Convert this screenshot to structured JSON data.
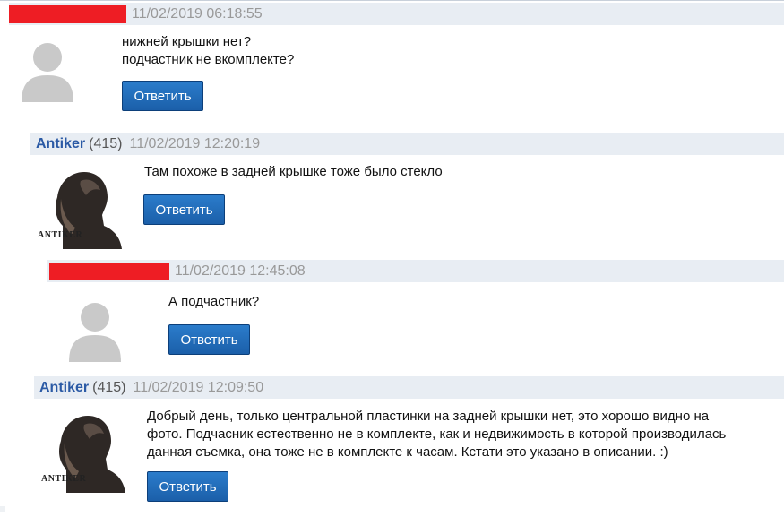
{
  "colors": {
    "accent": "#1b5fa9",
    "redaction": "#ee1d24",
    "header_bg": "#e8edf3",
    "author": "#2b5aa5",
    "date": "#999999"
  },
  "comments": [
    {
      "author_name": "",
      "author_redacted": true,
      "rating": "",
      "date": "11/02/2019 06:18:55",
      "text": [
        "нижней крышки нет?",
        "подчастник не вкомплекте?"
      ],
      "avatar": "default-user-icon",
      "reply_label": "Ответить"
    },
    {
      "author_name": "Antiker",
      "author_redacted": false,
      "rating": "(415)",
      "date": "11/02/2019 12:20:19",
      "text": [
        "Там похоже в задней крышке тоже было стекло"
      ],
      "avatar": "antiker-photo",
      "avatar_caption": "ANTIKER",
      "reply_label": "Ответить"
    },
    {
      "author_name": "",
      "author_redacted": true,
      "rating": "",
      "date": "11/02/2019 12:45:08",
      "text": [
        "А подчастник?"
      ],
      "avatar": "default-user-icon",
      "reply_label": "Ответить"
    },
    {
      "author_name": "Antiker",
      "author_redacted": false,
      "rating": "(415)",
      "date": "11/02/2019 12:09:50",
      "text": [
        "Добрый день, только центральной пластинки на задней крышки нет, это хорошо видно на",
        "фото. Подчасник естественно не в комплекте, как и недвижимость в которой производилась",
        "данная съемка, она тоже не в комплекте к часам. Кстати это указано в описании. :)"
      ],
      "avatar": "antiker-photo",
      "avatar_caption": "ANTIKER",
      "reply_label": "Ответить"
    }
  ]
}
